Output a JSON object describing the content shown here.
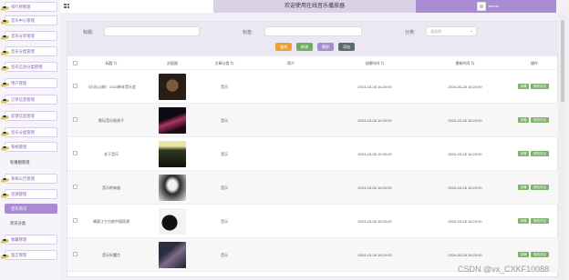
{
  "header": {
    "title": "欢迎使用在线音乐播放器",
    "user": "admin"
  },
  "sidebar": {
    "items": [
      {
        "label": "排行榜管理",
        "style": "normal"
      },
      {
        "label": "音乐中心管理",
        "style": "normal"
      },
      {
        "label": "音乐分享管理",
        "style": "normal"
      },
      {
        "label": "音乐分类管理",
        "style": "normal"
      },
      {
        "label": "音乐信息分类管理",
        "style": "normal"
      },
      {
        "label": "用户管理",
        "style": "normal"
      },
      {
        "label": "订单信息管理",
        "style": "normal"
      },
      {
        "label": "反馈信息管理",
        "style": "normal"
      },
      {
        "label": "音乐分类管理",
        "style": "normal"
      },
      {
        "label": "系统管理",
        "style": "normal"
      },
      {
        "label": "轮播图管理",
        "style": "plain"
      },
      {
        "label": "系统公告管理",
        "style": "normal"
      },
      {
        "label": "资源管理",
        "style": "normal"
      },
      {
        "label": "音乐资讯",
        "style": "active"
      },
      {
        "label": "资讯分类",
        "style": "plain"
      },
      {
        "label": "收藏管理",
        "style": "normal"
      },
      {
        "label": "留言管理",
        "style": "normal"
      }
    ]
  },
  "search": {
    "title_label": "标题:",
    "artist_label": "标签:",
    "category_label": "分类:",
    "category_placeholder": "请选择",
    "buttons": {
      "search": "查询",
      "add": "新增",
      "delete": "删除",
      "export": "添加"
    }
  },
  "table": {
    "columns": [
      "标题",
      "封面图",
      "文章分类",
      "简介",
      "创建时间",
      "更新时间",
      "操作"
    ],
    "actions": {
      "detail": "详情",
      "edit": "修改评论"
    },
    "rows": [
      {
        "title": "《乐队山林》 2024新年音乐会",
        "category": "音乐",
        "created": "2024-03-28 16:20:00",
        "updated": "2024-03-28 16:20:00"
      },
      {
        "title": "歌坛音乐剧孩子",
        "category": "音乐",
        "created": "2024-03-28 16:20:00",
        "updated": "2024-03-28 16:20:00"
      },
      {
        "title": "关于音乐",
        "category": "音乐",
        "created": "2024-03-28 16:20:00",
        "updated": "2024-03-28 16:20:00"
      },
      {
        "title": "音乐的味道",
        "category": "音乐",
        "created": "2024-03-28 16:20:00",
        "updated": "2024-03-28 16:20:00"
      },
      {
        "title": "晴夏江宁古韵中国巡演",
        "category": "音乐",
        "created": "2024-03-28 16:20:00",
        "updated": "2024-03-28 16:20:00"
      },
      {
        "title": "音乐好魔力",
        "category": "音乐",
        "created": "2024-03-28 16:20:00",
        "updated": "2024-03-28 16:20:00"
      }
    ]
  },
  "watermark": "CSDN @vx_CXKF10088",
  "colors": {
    "accent": "#a98bd3",
    "header_bg": "#d9d2e6",
    "search_btn": "#f0a030",
    "add_btn": "#6fae5c",
    "delete_btn": "#a98bd3",
    "export_btn": "#5c6b6e",
    "action_btn": "#7fb26d"
  }
}
